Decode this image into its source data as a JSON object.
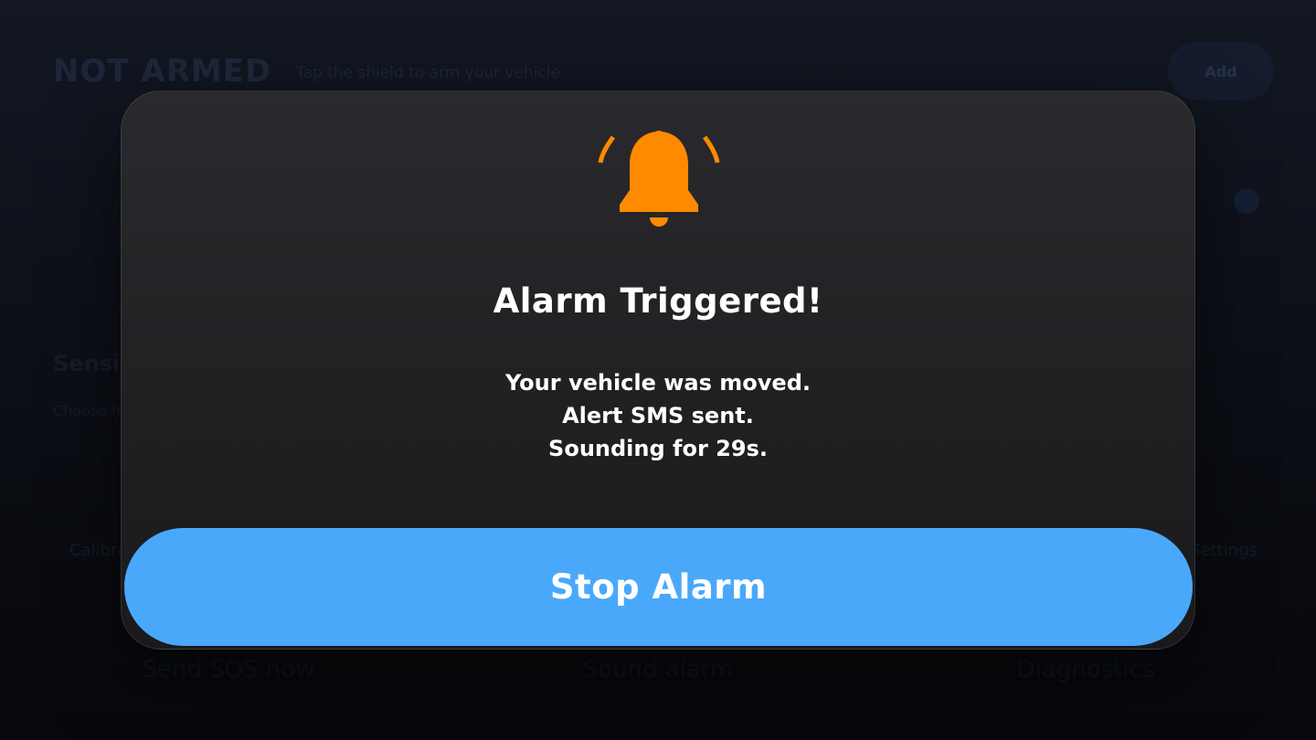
{
  "background": {
    "status_title": "NOT ARMED",
    "status_subtitle": "Tap the shield to arm your vehicle",
    "pill_label": "Add",
    "section_title": "Sensitivity",
    "section_subtitle": "Choose how easily the alarm triggers",
    "row_left_label": "Calibrate",
    "row_right_label": "Settings",
    "actions": [
      "Send SOS now",
      "Sound alarm",
      "Diagnostics"
    ]
  },
  "modal": {
    "icon": "bell-ringing-icon",
    "title": "Alarm Triggered!",
    "message_lines": [
      "Your vehicle was moved.",
      "Alert SMS sent.",
      "Sounding for 29s."
    ],
    "stop_button_label": "Stop Alarm"
  },
  "colors": {
    "accent_orange": "#ff8a00",
    "button_blue": "#4aa8fb",
    "modal_bg": "#232326",
    "text_white": "#ffffff"
  }
}
